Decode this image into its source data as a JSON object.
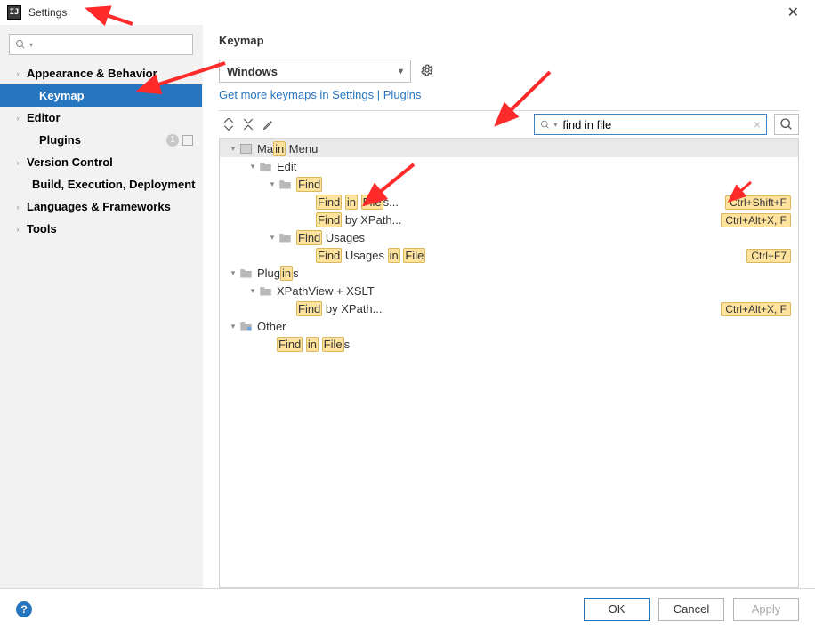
{
  "window": {
    "title": "Settings"
  },
  "sidebar": {
    "search_placeholder": "",
    "items": [
      {
        "label": "Appearance & Behavior",
        "chev": "›",
        "child": false,
        "sel": false
      },
      {
        "label": "Keymap",
        "chev": "",
        "child": true,
        "sel": true
      },
      {
        "label": "Editor",
        "chev": "›",
        "child": false,
        "sel": false
      },
      {
        "label": "Plugins",
        "chev": "",
        "child": true,
        "sel": false,
        "badge": "1"
      },
      {
        "label": "Version Control",
        "chev": "›",
        "child": false,
        "sel": false
      },
      {
        "label": "Build, Execution, Deployment",
        "chev": "",
        "child": true,
        "sel": false
      },
      {
        "label": "Languages & Frameworks",
        "chev": "›",
        "child": false,
        "sel": false
      },
      {
        "label": "Tools",
        "chev": "›",
        "child": false,
        "sel": false
      }
    ]
  },
  "page": {
    "title": "Keymap"
  },
  "keymap": {
    "scheme": "Windows",
    "link_a": "Get more keymaps in Settings",
    "link_b": "Plugins",
    "search_value": "find in file"
  },
  "tree": {
    "nodes": [
      {
        "d": 0,
        "arr": "v",
        "icon": "menu",
        "html": "Ma<span class='hl'>in</span> Menu",
        "sc": "",
        "hdr": true
      },
      {
        "d": 1,
        "arr": "v",
        "icon": "folder",
        "html": "Edit",
        "sc": ""
      },
      {
        "d": 2,
        "arr": "v",
        "icon": "folder",
        "html": "<span class='hl'>Find</span>",
        "sc": ""
      },
      {
        "d": 3,
        "arr": "",
        "icon": "",
        "html": "<span class='hl'>Find</span> <span class='hl'>in</span> <span class='hl'>File</span>s...",
        "sc": "Ctrl+Shift+F"
      },
      {
        "d": 3,
        "arr": "",
        "icon": "",
        "html": "<span class='hl'>Find</span> by XPath...",
        "sc": "Ctrl+Alt+X, F"
      },
      {
        "d": 2,
        "arr": "v",
        "icon": "folder",
        "html": "<span class='hl'>Find</span> Usages",
        "sc": ""
      },
      {
        "d": 3,
        "arr": "",
        "icon": "",
        "html": "<span class='hl'>Find</span> Usages <span class='hl'>in</span> <span class='hl'>File</span>",
        "sc": "Ctrl+F7"
      },
      {
        "d": 0,
        "arr": "v",
        "icon": "folder",
        "html": "Plug<span class='hl'>in</span>s",
        "sc": ""
      },
      {
        "d": 1,
        "arr": "v",
        "icon": "folder",
        "html": "XPathView + XSLT",
        "sc": ""
      },
      {
        "d": 2,
        "arr": "",
        "icon": "",
        "html": "<span class='hl'>Find</span> by XPath...",
        "sc": "Ctrl+Alt+X, F"
      },
      {
        "d": 0,
        "arr": "v",
        "icon": "other",
        "html": "Other",
        "sc": ""
      },
      {
        "d": 1,
        "arr": "",
        "icon": "",
        "html": "<span class='hl'>Find</span> <span class='hl'>in</span> <span class='hl'>File</span>s",
        "sc": ""
      }
    ]
  },
  "footer": {
    "ok": "OK",
    "cancel": "Cancel",
    "apply": "Apply"
  }
}
